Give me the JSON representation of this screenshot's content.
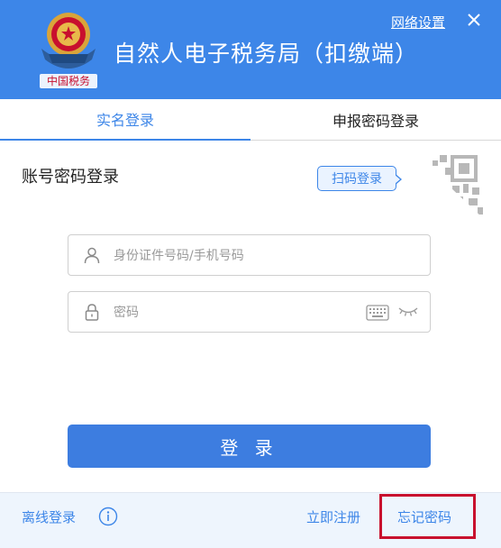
{
  "header": {
    "title": "自然人电子税务局（扣缴端）",
    "network_settings": "网络设置",
    "emblem_icon": "tax-emblem-icon",
    "emblem_text": "中国税务"
  },
  "tabs": [
    {
      "label": "实名登录",
      "active": true
    },
    {
      "label": "申报密码登录",
      "active": false
    }
  ],
  "login": {
    "section_title": "账号密码登录",
    "scan_label": "扫码登录",
    "username_placeholder": "身份证件号码/手机号码",
    "password_placeholder": "密码",
    "submit_label": "登 录"
  },
  "footer": {
    "offline_label": "离线登录",
    "register_label": "立即注册",
    "forgot_label": "忘记密码"
  },
  "colors": {
    "brand_blue": "#3d86e8",
    "button_blue": "#3d7de0",
    "highlight_red": "#c8102e"
  }
}
